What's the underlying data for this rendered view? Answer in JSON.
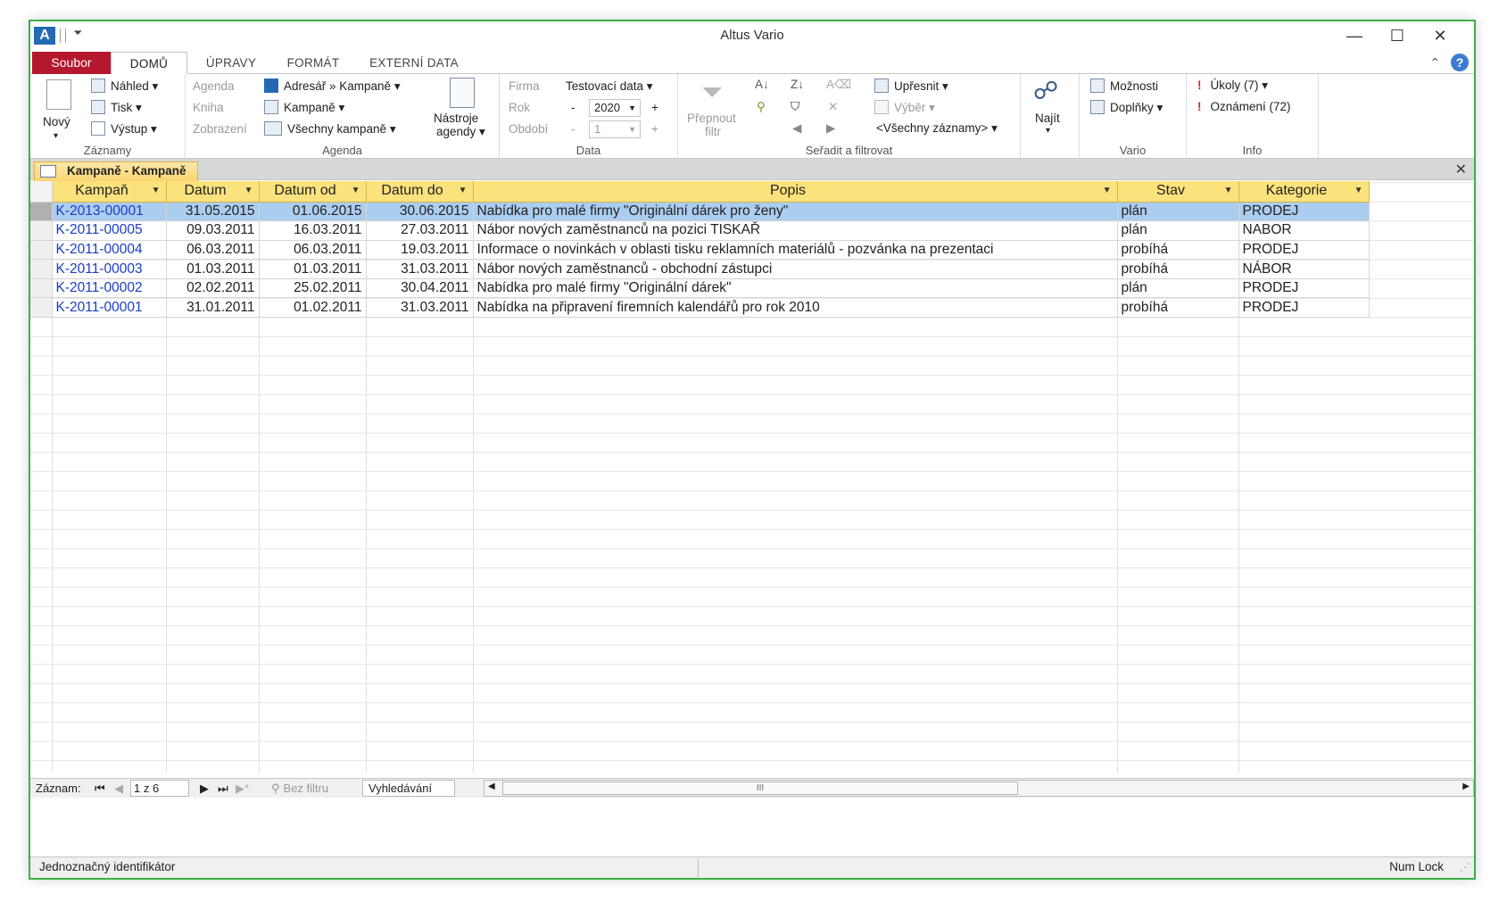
{
  "window": {
    "title": "Altus Vario",
    "controls": {
      "minimize": "—",
      "maximize": "☐",
      "close": "✕"
    }
  },
  "tabs": {
    "file": "Soubor",
    "items": [
      "DOMŮ",
      "ÚPRAVY",
      "FORMÁT",
      "EXTERNÍ DATA"
    ],
    "active": "DOMŮ"
  },
  "ribbon": {
    "zaznamy": {
      "label": "Záznamy",
      "novy": "Nový",
      "nahled": "Náhled ▾",
      "tisk": "Tisk ▾",
      "vystup": "Výstup ▾"
    },
    "agenda": {
      "label": "Agenda",
      "agenda_lbl": "Agenda",
      "kniha_lbl": "Kniha",
      "zobrazeni_lbl": "Zobrazení",
      "agenda_val": "Adresář » Kampaně ▾",
      "kniha_val": "Kampaně ▾",
      "zobrazeni_val": "Všechny kampaně ▾",
      "nastroje_1": "Nástroje",
      "nastroje_2": "agendy ▾"
    },
    "data": {
      "label": "Data",
      "firma_lbl": "Firma",
      "firma_val": "Testovací data ▾",
      "rok_lbl": "Rok",
      "rok_val": "2020",
      "obdobi_lbl": "Období",
      "obdobi_val": "1",
      "minus": "-",
      "plus": "+"
    },
    "filter": {
      "label": "Seřadit a filtrovat",
      "prepnout_1": "Přepnout",
      "prepnout_2": "filtr",
      "upresnit": "Upřesnit ▾",
      "vyber": "Výběr ▾",
      "vsechny": "<Všechny záznamy> ▾"
    },
    "najit": "Najít",
    "vario": {
      "label": "Vario",
      "moznosti": "Možnosti",
      "doplnky": "Doplňky ▾"
    },
    "info": {
      "label": "Info",
      "ukoly": "Úkoly (7) ▾",
      "oznameni": "Oznámení (72)"
    }
  },
  "doc_tab": "Kampaně - Kampaně",
  "table": {
    "headers": [
      "Kampaň",
      "Datum",
      "Datum od",
      "Datum do",
      "Popis",
      "Stav",
      "Kategorie"
    ],
    "rows": [
      [
        "K-2013-00001",
        "31.05.2015",
        "01.06.2015",
        "30.06.2015",
        "Nabídka pro malé firmy \"Originální dárek pro ženy\"",
        "plán",
        "PRODEJ"
      ],
      [
        "K-2011-00005",
        "09.03.2011",
        "16.03.2011",
        "27.03.2011",
        "Nábor nových zaměstnanců na pozici TISKAŘ",
        "plán",
        "NABOR"
      ],
      [
        "K-2011-00004",
        "06.03.2011",
        "06.03.2011",
        "19.03.2011",
        "Informace o novinkách v oblasti tisku reklamních materiálů - pozvánka na prezentaci",
        "probíhá",
        "PRODEJ"
      ],
      [
        "K-2011-00003",
        "01.03.2011",
        "01.03.2011",
        "31.03.2011",
        "Nábor nových zaměstnanců - obchodní zástupci",
        "probíhá",
        "NÁBOR"
      ],
      [
        "K-2011-00002",
        "02.02.2011",
        "25.02.2011",
        "30.04.2011",
        "Nabídka pro malé firmy \"Originální dárek\"",
        "plán",
        "PRODEJ"
      ],
      [
        "K-2011-00001",
        "31.01.2011",
        "01.02.2011",
        "31.03.2011",
        "Nabídka na připravení firemních kalendářů pro rok 2010",
        "probíhá",
        "PRODEJ"
      ]
    ]
  },
  "navbar": {
    "zaznam": "Záznam:",
    "position": "1 z 6",
    "bez_filtru": "Bez filtru",
    "vyhledavani": "Vyhledávání"
  },
  "status": {
    "left": "Jednoznačný identifikátor",
    "right": "Num Lock"
  }
}
